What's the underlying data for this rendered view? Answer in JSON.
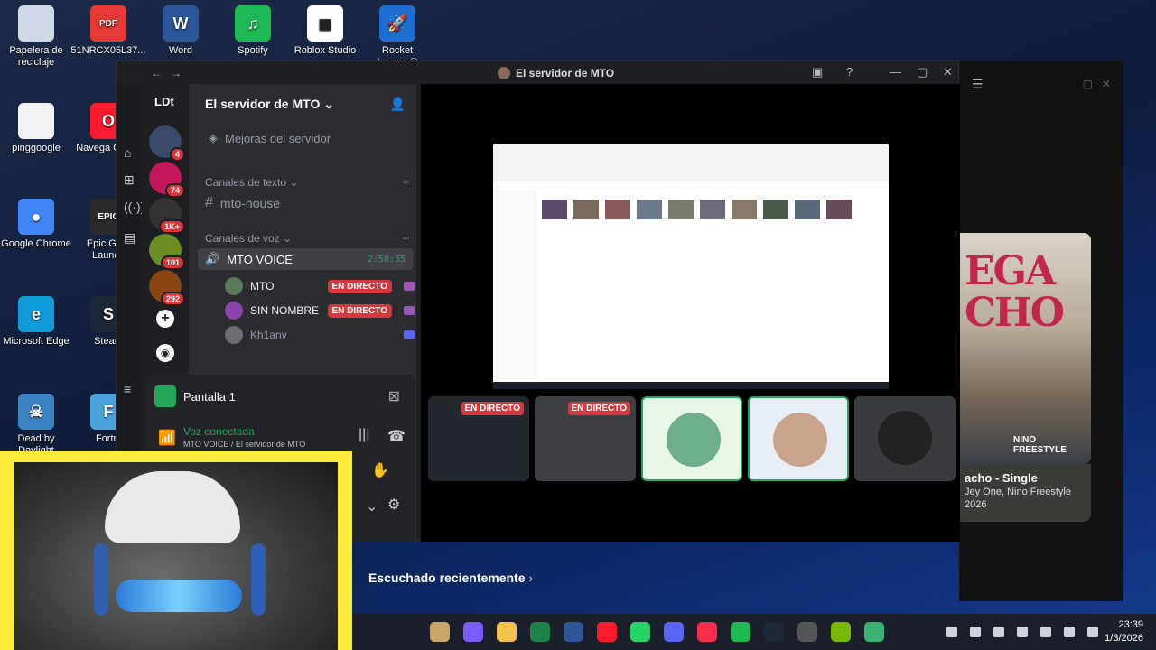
{
  "desktop": {
    "icons": [
      {
        "label": "Papelera de reciclaje",
        "icon": "recycle-bin-icon",
        "color": "#cfd8e6"
      },
      {
        "label": "51NRCX05L37...",
        "icon": "pdf-icon",
        "color": "#e53935",
        "glyph": "PDF"
      },
      {
        "label": "Word",
        "icon": "word-icon",
        "color": "#2b579a",
        "glyph": "W"
      },
      {
        "label": "Spotify",
        "icon": "spotify-icon",
        "color": "#1db954",
        "glyph": "♫"
      },
      {
        "label": "Roblox Studio",
        "icon": "roblox-icon",
        "color": "#ffffff",
        "glyph": "◼"
      },
      {
        "label": "Rocket League®",
        "icon": "rocket-league-icon",
        "color": "#1f6fd1",
        "glyph": "🚀"
      },
      {
        "label": "pinggoogle",
        "icon": "text-file-icon",
        "color": "#f2f2f2",
        "glyph": ""
      },
      {
        "label": "Navega Opera",
        "icon": "opera-icon",
        "color": "#ff1b2d",
        "glyph": "O"
      },
      {
        "label": "Google Chrome",
        "icon": "chrome-icon",
        "color": "#4285f4",
        "glyph": "●"
      },
      {
        "label": "Epic Gam Launch",
        "icon": "epic-games-icon",
        "color": "#2a2a2a",
        "glyph": "EPIC"
      },
      {
        "label": "Microsoft Edge",
        "icon": "edge-icon",
        "color": "#0f9bd7",
        "glyph": "e"
      },
      {
        "label": "Steam",
        "icon": "steam-icon",
        "color": "#1b2838",
        "glyph": "S"
      },
      {
        "label": "Dead by Daylight",
        "icon": "dbd-icon",
        "color": "#3b82c4",
        "glyph": "☠"
      },
      {
        "label": "Fortni",
        "icon": "fortnite-icon",
        "color": "#4aa3df",
        "glyph": "F"
      }
    ]
  },
  "discord": {
    "window_title": "El servidor de MTO",
    "server_name": "El servidor de MTO",
    "user_tag": "LDt",
    "boost_label": "Mejoras del servidor",
    "text_category": "Canales de texto",
    "text_channel": "mto-house",
    "voice_category": "Canales de voz",
    "voice_channel": "MTO VOICE",
    "voice_timer": "2:58:35",
    "servers": [
      {
        "badge": "4",
        "color": "#3a4a6b"
      },
      {
        "badge": "74",
        "color": "#c2185b"
      },
      {
        "badge": "1K+",
        "color": "#333333"
      },
      {
        "badge": "101",
        "color": "#6b8e23"
      },
      {
        "badge": "292",
        "color": "#8b4513"
      }
    ],
    "voice_users": [
      {
        "name": "MTO",
        "live": "EN DIRECTO",
        "avatar_color": "#5a7a5a"
      },
      {
        "name": "SIN NOMBRE",
        "live": "EN DIRECTO",
        "avatar_color": "#8e44ad"
      },
      {
        "name": "Kh1anv",
        "live": "",
        "avatar_color": "#6d6f75"
      }
    ],
    "screen_panel_title": "Pantalla 1",
    "voice_status": "Voz conectada",
    "voice_status_sub": "MTO VOICE / El servidor de MTO",
    "stream_tiles": [
      {
        "live": "EN DIRECTO",
        "color": "#23272e"
      },
      {
        "live": "EN DIRECTO",
        "color": "#3d3f44"
      },
      {
        "live": "",
        "color": "#e8f5e9"
      },
      {
        "live": "",
        "color": "#e8eef5"
      },
      {
        "live": "",
        "color": "#3a3c40"
      }
    ],
    "accent_live": "#da373c",
    "accent_green": "#23a55a"
  },
  "spotify": {
    "album_art_text": "EGA CHO",
    "album_art_label": "NINO FREESTYLE",
    "song_title": "acho - Single",
    "artists": "Jey One, Nino Freestyle",
    "year": "2026",
    "recent_label": "Escuchado recientemente"
  },
  "taskbar": {
    "time": "23:39",
    "date": "1/3/2026"
  }
}
